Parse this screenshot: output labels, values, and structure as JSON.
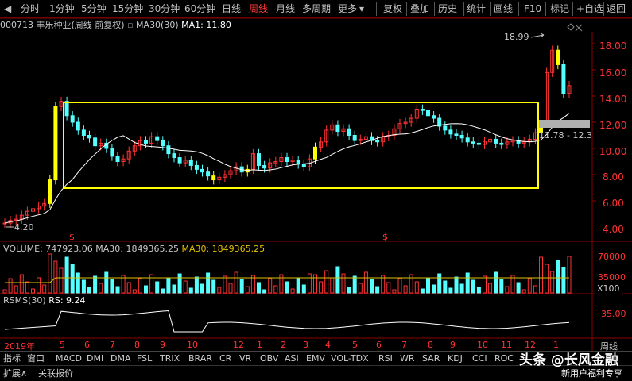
{
  "toolbar": {
    "left": [
      "分时",
      "1分钟",
      "5分钟",
      "15分钟",
      "30分钟",
      "60分钟",
      "日线",
      "周线",
      "月线",
      "多周期",
      "更多"
    ],
    "active": "周线",
    "right": [
      "复权",
      "叠加",
      "历史",
      "统计",
      "画线",
      "F10",
      "标记",
      "+自选",
      "返回"
    ]
  },
  "info": {
    "code_name": "000713 丰乐种业(周线 前复权)",
    "ma_label": "MA30(30)",
    "ma1": "MA1: 11.80"
  },
  "price_axis": [
    "18.00",
    "16.00",
    "14.00",
    "12.00",
    "10.00",
    "8.00",
    "6.00",
    "4.00"
  ],
  "annotations": {
    "high": "18.99",
    "low": "4.20",
    "box_range": "11.78 - 12.3"
  },
  "volume": {
    "label": "VOLUME: 747923.06",
    "ma30a": "MA30: 1849365.25",
    "ma30b": "MA30: 1849365.25",
    "axis": [
      "70000",
      "35000",
      "X100"
    ]
  },
  "rsms": {
    "label": "RSMS(30)",
    "value": "RS: 9.24",
    "axis": [
      "35.00"
    ]
  },
  "time_axis": {
    "labels": [
      "2019年",
      "5",
      "6",
      "7",
      "8",
      "9",
      "10",
      "12",
      "1",
      "2",
      "3",
      "4",
      "5",
      "6",
      "7",
      "8",
      "9",
      "10",
      "11",
      "12",
      "1"
    ],
    "period": "周线"
  },
  "indicators": [
    "指标",
    "窗口",
    "MACD",
    "DMI",
    "DMA",
    "FSL",
    "TRIX",
    "BRAR",
    "CR",
    "VR",
    "OBV",
    "ASI",
    "EMV",
    "VOL-TDX",
    "RSI",
    "WR",
    "SAR",
    "KDJ",
    "CCI",
    "ROC"
  ],
  "bottom": [
    "扩展∧",
    "关联报价"
  ],
  "watermark": {
    "title": "头条 @长风金融",
    "sub": "新用户福利专享"
  },
  "colors": {
    "up": "#ff3232",
    "down": "#54ffff",
    "box": "#ffff00",
    "ma": "#ffffff",
    "grid": "#8b0000"
  }
}
